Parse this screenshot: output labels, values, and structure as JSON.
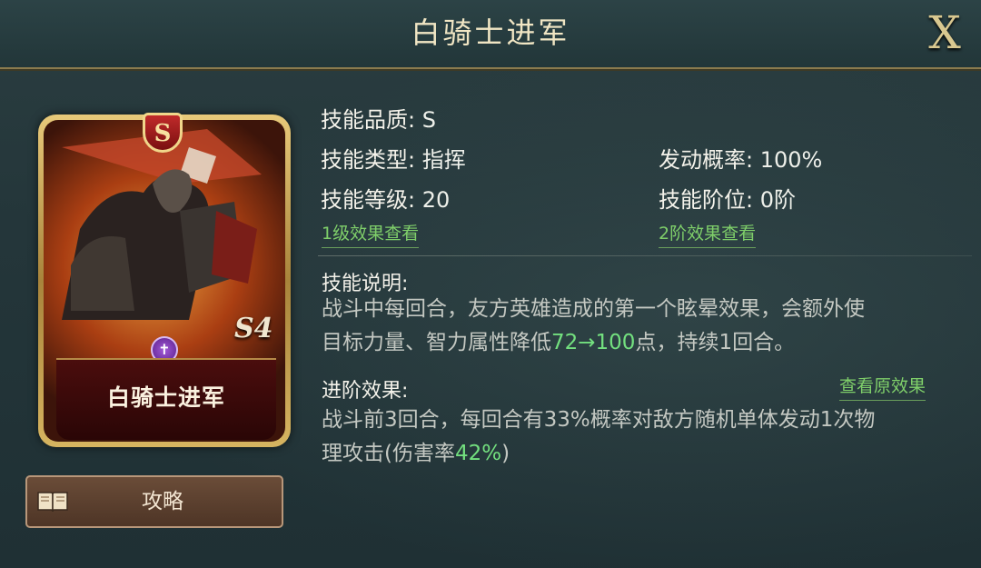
{
  "window": {
    "title": "白骑士进军",
    "close_label": "X"
  },
  "card": {
    "grade": "S",
    "mark": "S4",
    "name": "白骑士进军"
  },
  "guide_button": {
    "label": "攻略"
  },
  "stats": {
    "quality": {
      "label": "技能品质: ",
      "value": "S"
    },
    "type": {
      "label": "技能类型: ",
      "value": "指挥"
    },
    "level": {
      "label": "技能等级: ",
      "value": "20"
    },
    "chance": {
      "label": "发动概率: ",
      "value": "100%"
    },
    "tier": {
      "label": "技能阶位: ",
      "value": "0阶"
    }
  },
  "links": {
    "level1": "1级效果查看",
    "tier2": "2阶效果查看",
    "original": "查看原效果"
  },
  "description": {
    "heading": "技能说明:",
    "line1": "战斗中每回合，友方英雄造成的第一个眩晕效果，会额外使",
    "line2_a": "目标力量、智力属性降低",
    "line2_hl": "72→100",
    "line2_b": "点，持续1回合。"
  },
  "advance": {
    "heading": "进阶效果:",
    "line1": "战斗前3回合，每回合有33%概率对敌方随机单体发动1次物",
    "line2_a": "理攻击(伤害率",
    "line2_hl": "42%",
    "line2_b": ")"
  },
  "colors": {
    "highlight": "#73e07f",
    "link": "#7fcf6a",
    "title": "#f1e6c4"
  }
}
